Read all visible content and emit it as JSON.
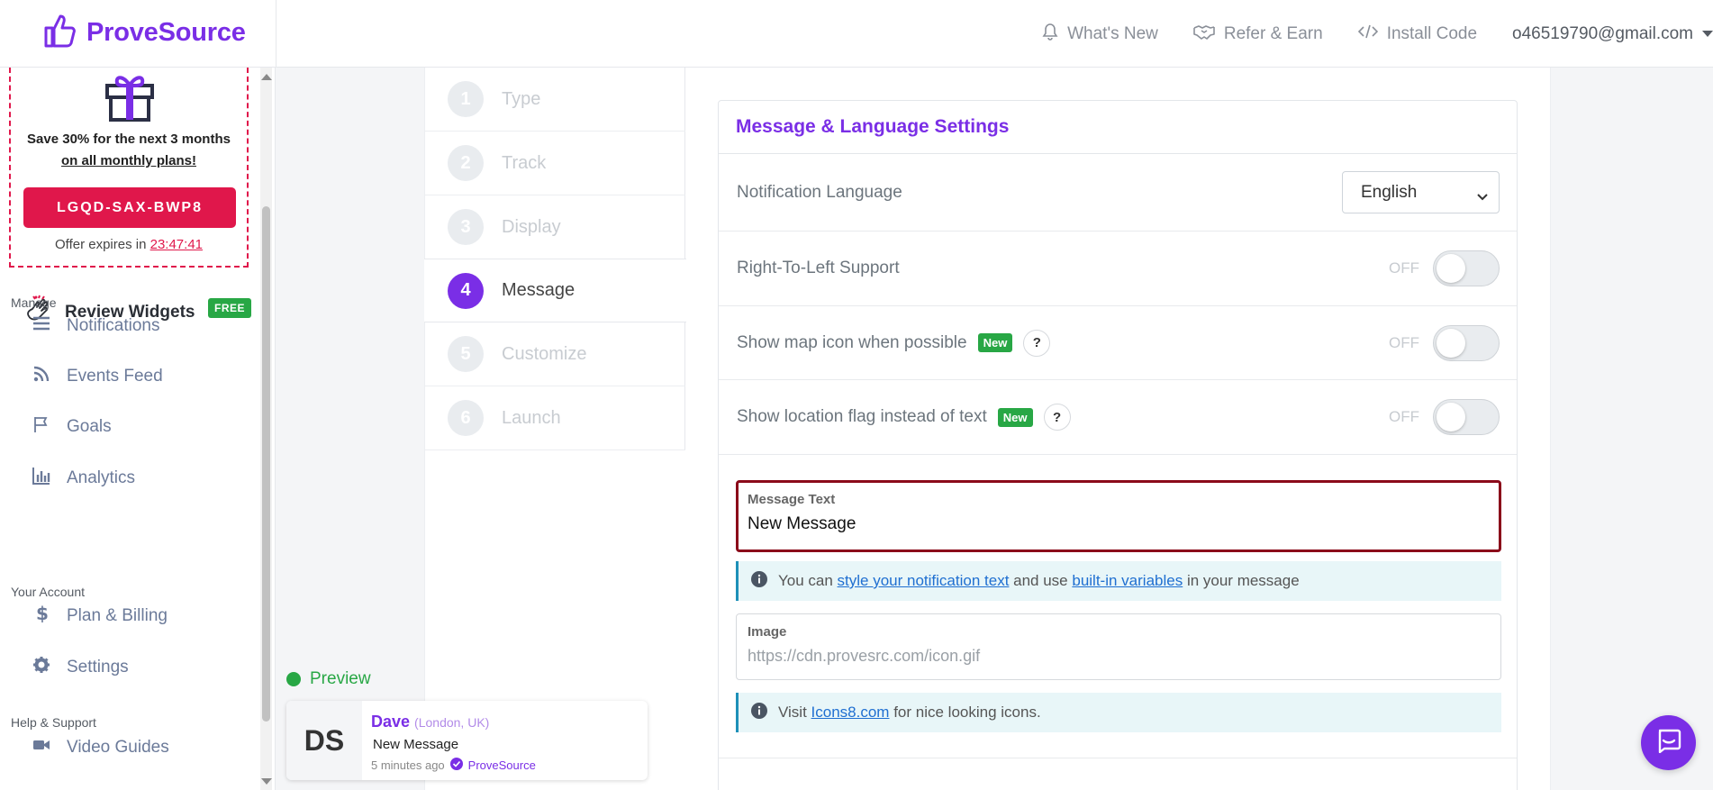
{
  "brand": {
    "name": "ProveSource",
    "color": "#7a2ee6"
  },
  "topnav": {
    "whats_new": "What's New",
    "refer": "Refer & Earn",
    "install": "Install Code",
    "email": "o46519790@gmail.com"
  },
  "promo": {
    "line1": "Save 30% for the next 3 months",
    "line2": "on all monthly plans!",
    "code": "LGQD-SAX-BWP8",
    "expires_prefix": "Offer expires in ",
    "expires_time": "23:47:41"
  },
  "sidebar": {
    "review_widgets": "Review Widgets",
    "free_badge": "FREE",
    "section_manage": "Manage",
    "notifications": "Notifications",
    "events_feed": "Events Feed",
    "goals": "Goals",
    "analytics": "Analytics",
    "section_account": "Your Account",
    "plan_billing": "Plan & Billing",
    "settings": "Settings",
    "section_help": "Help & Support",
    "video_guides": "Video Guides"
  },
  "steps": [
    {
      "num": "1",
      "label": "Type"
    },
    {
      "num": "2",
      "label": "Track"
    },
    {
      "num": "3",
      "label": "Display"
    },
    {
      "num": "4",
      "label": "Message"
    },
    {
      "num": "5",
      "label": "Customize"
    },
    {
      "num": "6",
      "label": "Launch"
    }
  ],
  "preview": {
    "label": "Preview",
    "initials": "DS",
    "name": "Dave",
    "location": "(London, UK)",
    "message": "New Message",
    "time": "5 minutes ago",
    "verified_by": "ProveSource"
  },
  "panel": {
    "title": "Message & Language Settings",
    "language_label": "Notification Language",
    "language_value": "English",
    "rtl_label": "Right-To-Left Support",
    "map_icon_label": "Show map icon when possible",
    "flag_label": "Show location flag instead of text",
    "new_badge": "New",
    "off": "OFF",
    "qmark": "?",
    "message_text_label": "Message Text",
    "message_text_value": "New Message",
    "info1_a": "You can ",
    "info1_link1": "style your notification text",
    "info1_b": " and use ",
    "info1_link2": "built-in variables",
    "info1_c": " in your message",
    "image_label": "Image",
    "image_placeholder": "https://cdn.provesrc.com/icon.gif",
    "info2_a": "Visit ",
    "info2_link": "Icons8.com",
    "info2_b": " for nice looking icons."
  },
  "colors": {
    "accent": "#7a2ee6",
    "danger": "#e0174b",
    "success": "#28a745",
    "focus_border": "#8b0a1a"
  }
}
